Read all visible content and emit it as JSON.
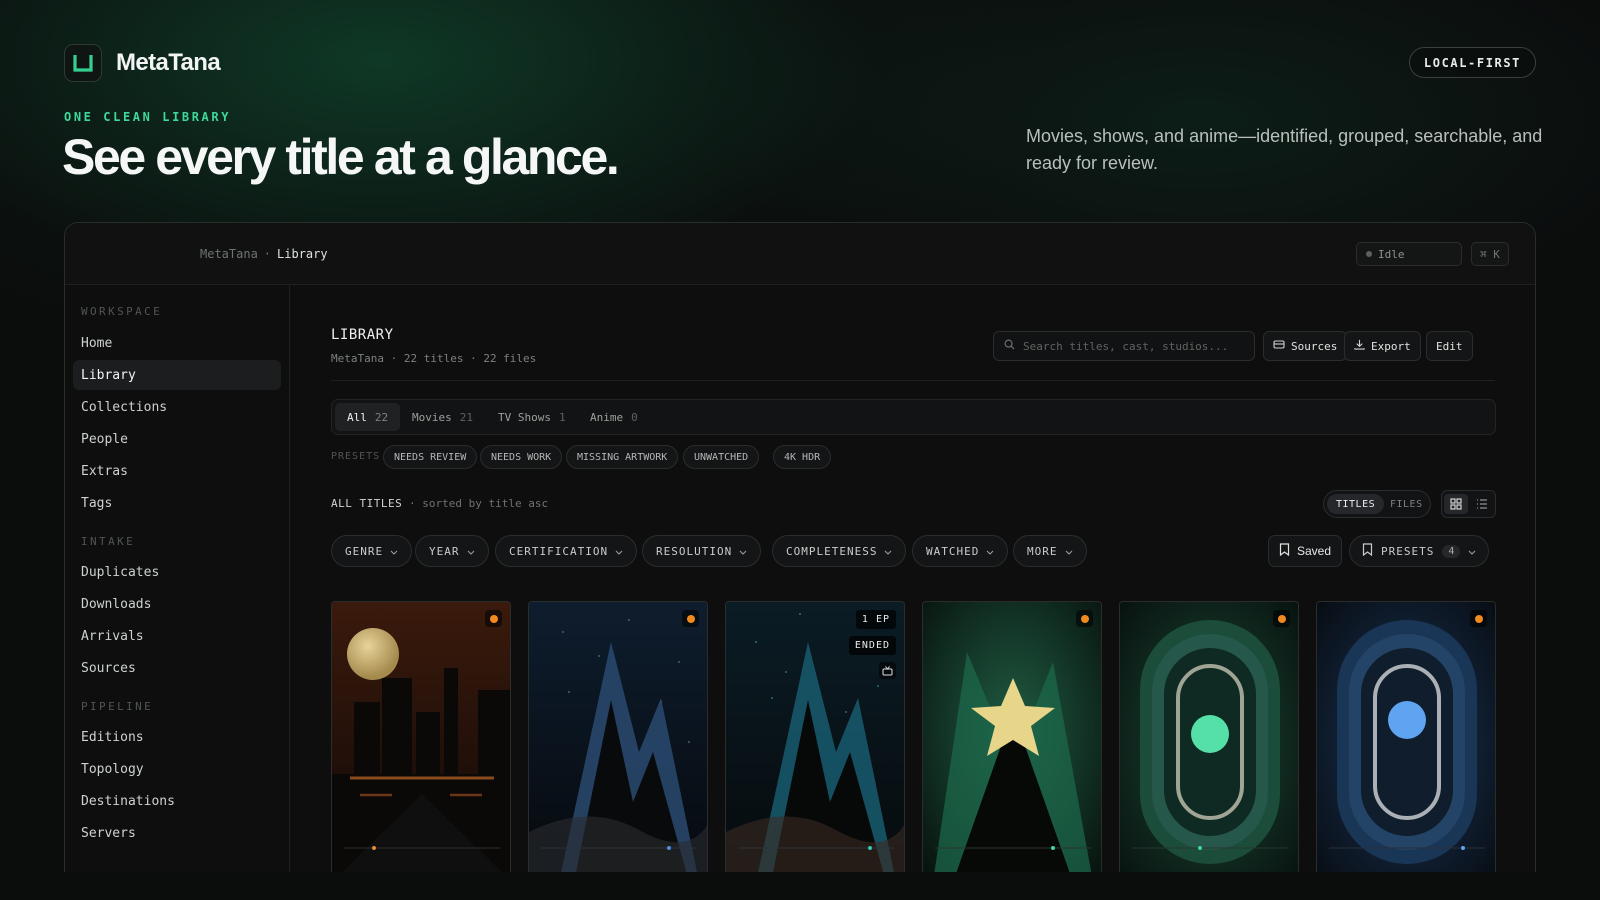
{
  "brand": {
    "name": "MetaTana"
  },
  "hero": {
    "badge": "LOCAL-FIRST",
    "eyebrow": "ONE CLEAN LIBRARY",
    "headline": "See every title at a glance.",
    "tagline": "Movies, shows, and anime—identified, grouped, searchable, and ready for review."
  },
  "topbar": {
    "breadcrumb_root": "MetaTana",
    "breadcrumb_sep": "·",
    "breadcrumb_current": "Library",
    "status": "Idle",
    "shortcut": "⌘ K"
  },
  "sidebar": {
    "sections": [
      {
        "label": "WORKSPACE",
        "items": [
          "Home",
          "Library",
          "Collections",
          "People",
          "Extras",
          "Tags"
        ]
      },
      {
        "label": "INTAKE",
        "items": [
          "Duplicates",
          "Downloads",
          "Arrivals",
          "Sources"
        ]
      },
      {
        "label": "PIPELINE",
        "items": [
          "Editions",
          "Topology",
          "Destinations",
          "Servers"
        ]
      }
    ],
    "active": "Library"
  },
  "library": {
    "title": "LIBRARY",
    "subtitle": "MetaTana · 22 titles · 22 files",
    "search_placeholder": "Search titles, cast, studios...",
    "sources_label": "Sources",
    "export_label": "Export",
    "edit_label": "Edit"
  },
  "tabs": [
    {
      "label": "All",
      "count": "22"
    },
    {
      "label": "Movies",
      "count": "21"
    },
    {
      "label": "TV Shows",
      "count": "1"
    },
    {
      "label": "Anime",
      "count": "0"
    }
  ],
  "presets": {
    "label": "PRESETS",
    "chips": [
      "NEEDS REVIEW",
      "NEEDS WORK",
      "MISSING ARTWORK",
      "UNWATCHED",
      "4K HDR"
    ]
  },
  "listing": {
    "heading": "ALL TITLES",
    "sort": "·  sorted by title asc",
    "mode_titles": "TITLES",
    "mode_files": "FILES"
  },
  "filters": [
    "GENRE",
    "YEAR",
    "CERTIFICATION",
    "RESOLUTION",
    "COMPLETENESS",
    "WATCHED",
    "MORE"
  ],
  "saved_label": "Saved",
  "presets_button": {
    "label": "PRESETS",
    "count": "4"
  },
  "cards": [
    {
      "art": "city-moon",
      "badges": []
    },
    {
      "art": "blue-peaks",
      "badges": []
    },
    {
      "art": "teal-peaks",
      "badges": [
        "1 EP",
        "ENDED"
      ]
    },
    {
      "art": "star-peak",
      "badges": []
    },
    {
      "art": "green-ring",
      "badges": []
    },
    {
      "art": "blue-ring",
      "badges": []
    }
  ],
  "colors": {
    "accent": "#3fd79a",
    "status_dot": "#f08a1e",
    "background": "#0b0c0c"
  }
}
